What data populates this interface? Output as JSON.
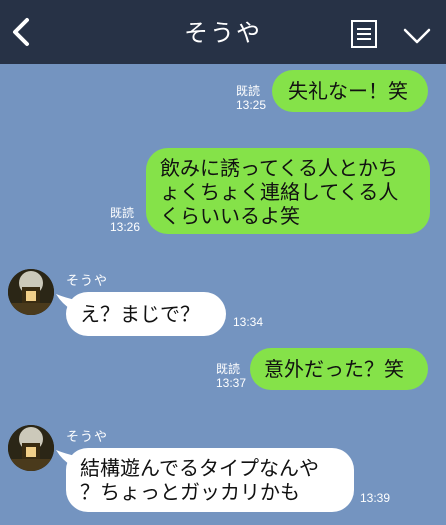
{
  "header": {
    "title": "そうや",
    "back_icon": "chevron-left-icon",
    "memo_icon": "note-list-icon",
    "menu_icon": "chevron-down-icon",
    "bg_color": "#273246"
  },
  "colors": {
    "background": "#7494c0",
    "my_bubble": "#85e249",
    "their_bubble": "#ffffff"
  },
  "messages": [
    {
      "from": "me",
      "text": "失礼なー！笑",
      "read_label": "既読",
      "time": "13:25"
    },
    {
      "from": "me",
      "text": "飲みに誘ってくる人とかち\nょくちょく連絡してくる人\nくらいいるよ笑",
      "read_label": "既読",
      "time": "13:26"
    },
    {
      "from": "other",
      "sender": "そうや",
      "text": "え？まじで？",
      "time": "13:34"
    },
    {
      "from": "me",
      "text": "意外だった？笑",
      "read_label": "既読",
      "time": "13:37"
    },
    {
      "from": "other",
      "sender": "そうや",
      "text": "結構遊んでるタイプなんや\n？ちょっとガッカリかも",
      "time": "13:39"
    }
  ]
}
